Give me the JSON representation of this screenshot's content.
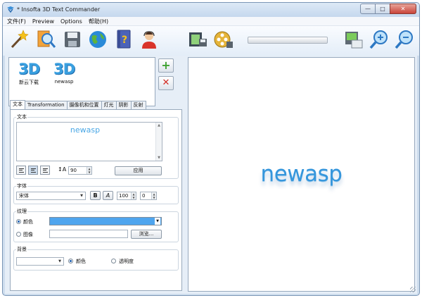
{
  "window": {
    "title": "* Insofta 3D Text Commander",
    "minimize": "—",
    "maximize": "□",
    "close": "✕"
  },
  "menu": [
    {
      "label": "文件(F)"
    },
    {
      "label": "Preview"
    },
    {
      "label": "Options"
    },
    {
      "label": "帮助(H)"
    }
  ],
  "toolbar": {
    "icons": [
      "magic-wand-icon",
      "preview-icon",
      "save-icon",
      "globe-icon",
      "help-book-icon",
      "support-person-icon",
      "film-save-icon",
      "film-reel-icon",
      "export-image-icon",
      "zoom-in-icon",
      "zoom-out-icon"
    ]
  },
  "presets": [
    {
      "logo": "3D",
      "label": "新云下载"
    },
    {
      "logo": "3D",
      "label": "newasp"
    }
  ],
  "actions": {
    "add": "+",
    "remove": "✕"
  },
  "tabs": [
    {
      "label": "文本"
    },
    {
      "label": "Transformation"
    },
    {
      "label": "摄像机和位置"
    },
    {
      "label": "灯光"
    },
    {
      "label": "阴影"
    },
    {
      "label": "反射"
    }
  ],
  "text_group": {
    "label": "文本",
    "value": "newasp",
    "line_spacing": "90",
    "apply": "应用"
  },
  "font_group": {
    "label": "字体",
    "font": "宋体",
    "bold": "B",
    "italic": "A",
    "size": "100",
    "spacing": "0"
  },
  "texture_group": {
    "label": "纹理",
    "color_label": "颜色",
    "image_label": "图像",
    "browse": "浏览...",
    "color": "#4fa5ee"
  },
  "bg_group": {
    "label": "背景",
    "color_label": "颜色",
    "transparent_label": "透明度"
  },
  "preview": {
    "text": "newasp"
  }
}
